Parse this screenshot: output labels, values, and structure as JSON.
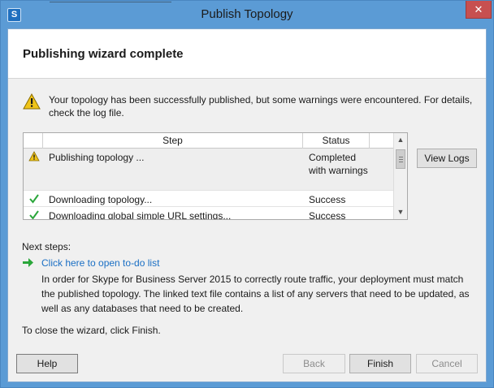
{
  "window": {
    "title": "Publish Topology",
    "close_glyph": "✕",
    "app_icon_letter": "S"
  },
  "header": {
    "title": "Publishing wizard complete"
  },
  "status": {
    "icon": "warning-icon",
    "message": "Your topology has been successfully published, but some warnings were encountered. For details, check the log file."
  },
  "grid": {
    "columns": [
      "Step",
      "Status"
    ],
    "rows": [
      {
        "icon": "warning-icon",
        "step": "Publishing topology ...",
        "status": "Completed with warnings"
      },
      {
        "icon": "checkmark-icon",
        "step": "Downloading topology...",
        "status": "Success"
      },
      {
        "icon": "checkmark-icon",
        "step": "Downloading global simple URL settings...",
        "status": "Success"
      }
    ]
  },
  "view_logs_label": "View Logs",
  "next_steps": {
    "label": "Next steps:",
    "link_text": "Click here to open to-do list",
    "explanation": "In order for Skype for Business Server 2015 to correctly route traffic, your deployment must match the published topology. The linked text file contains a list of any servers that need to be updated, as well as any databases that need to be created."
  },
  "close_hint": "To close the wizard, click Finish.",
  "footer": {
    "help_label": "Help",
    "back_label": "Back",
    "finish_label": "Finish",
    "cancel_label": "Cancel"
  },
  "colors": {
    "title_bar": "#5b9bd5",
    "close_button": "#c75050",
    "link": "#1a6fc4",
    "success_check": "#2aa63a",
    "warning": "#f0c419"
  }
}
